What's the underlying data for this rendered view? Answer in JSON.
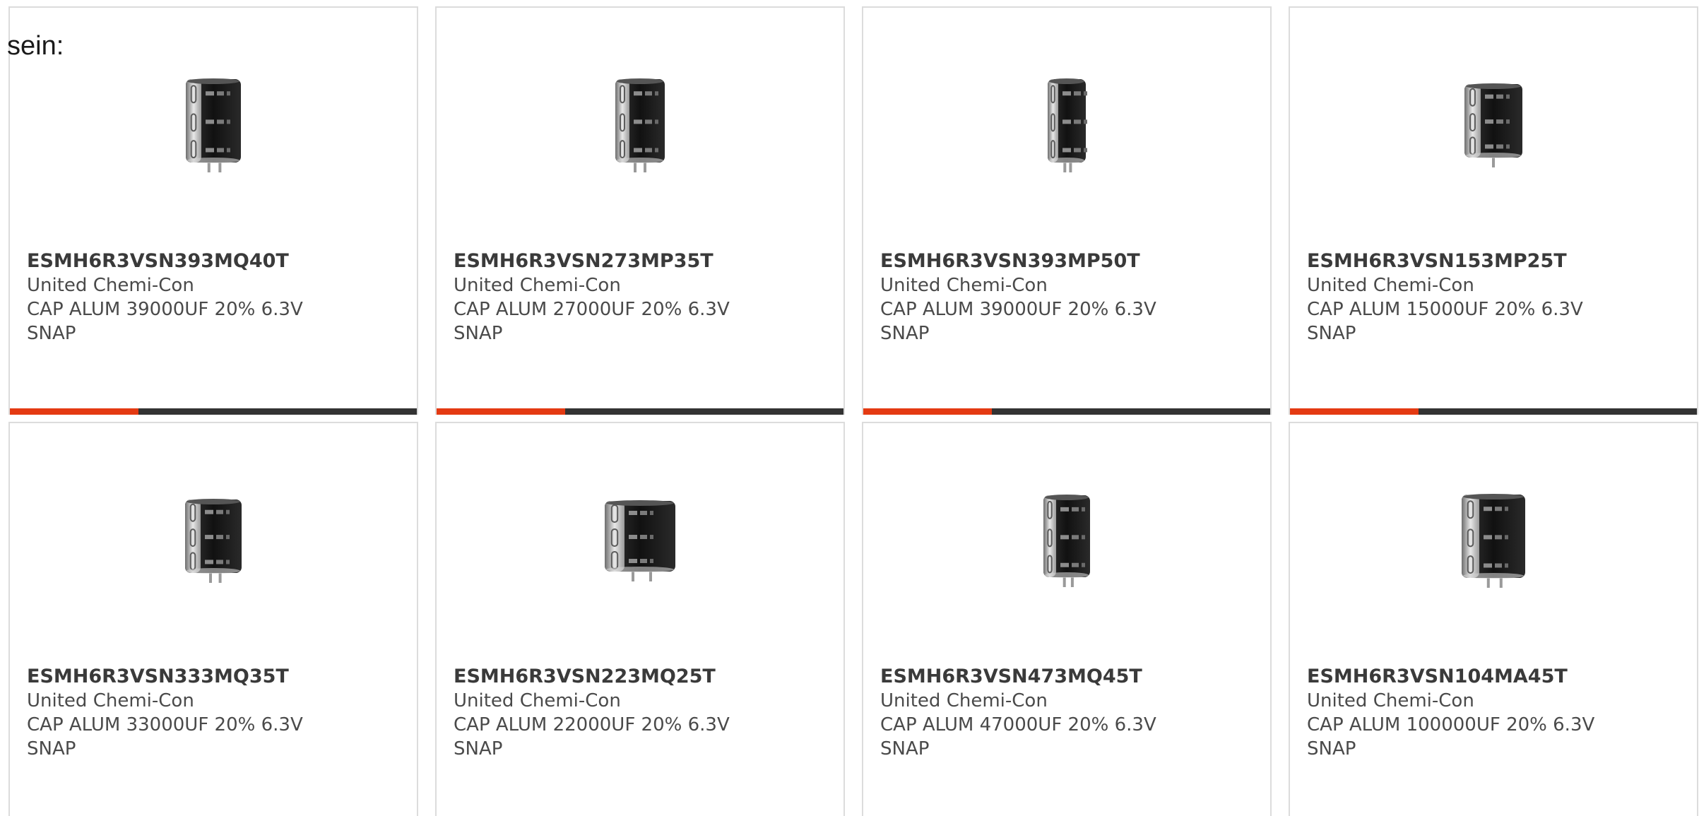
{
  "intro": {
    "text": "sein:"
  },
  "colors": {
    "accent": "#e43a12",
    "bar": "#333333",
    "border": "#dcdcdc"
  },
  "products": [
    {
      "part_number": "ESMH6R3VSN393MQ40T",
      "manufacturer": "United Chemi-Con",
      "desc_line1": "CAP ALUM 39000UF 20% 6.3V",
      "desc_line2": "SNAP",
      "icon": "capacitor-image",
      "show_bar": true
    },
    {
      "part_number": "ESMH6R3VSN273MP35T",
      "manufacturer": "United Chemi-Con",
      "desc_line1": "CAP ALUM 27000UF 20% 6.3V",
      "desc_line2": "SNAP",
      "icon": "capacitor-image",
      "show_bar": true
    },
    {
      "part_number": "ESMH6R3VSN393MP50T",
      "manufacturer": "United Chemi-Con",
      "desc_line1": "CAP ALUM 39000UF 20% 6.3V",
      "desc_line2": "SNAP",
      "icon": "capacitor-image",
      "show_bar": true
    },
    {
      "part_number": "ESMH6R3VSN153MP25T",
      "manufacturer": "United Chemi-Con",
      "desc_line1": "CAP ALUM 15000UF 20% 6.3V",
      "desc_line2": "SNAP",
      "icon": "capacitor-image",
      "show_bar": true
    },
    {
      "part_number": "ESMH6R3VSN333MQ35T",
      "manufacturer": "United Chemi-Con",
      "desc_line1": "CAP ALUM 33000UF 20% 6.3V",
      "desc_line2": "SNAP",
      "icon": "capacitor-image",
      "show_bar": false
    },
    {
      "part_number": "ESMH6R3VSN223MQ25T",
      "manufacturer": "United Chemi-Con",
      "desc_line1": "CAP ALUM 22000UF 20% 6.3V",
      "desc_line2": "SNAP",
      "icon": "capacitor-image",
      "show_bar": false
    },
    {
      "part_number": "ESMH6R3VSN473MQ45T",
      "manufacturer": "United Chemi-Con",
      "desc_line1": "CAP ALUM 47000UF 20% 6.3V",
      "desc_line2": "SNAP",
      "icon": "capacitor-image",
      "show_bar": false
    },
    {
      "part_number": "ESMH6R3VSN104MA45T",
      "manufacturer": "United Chemi-Con",
      "desc_line1": "CAP ALUM 100000UF 20% 6.3V",
      "desc_line2": "SNAP",
      "icon": "capacitor-image",
      "show_bar": false
    }
  ]
}
